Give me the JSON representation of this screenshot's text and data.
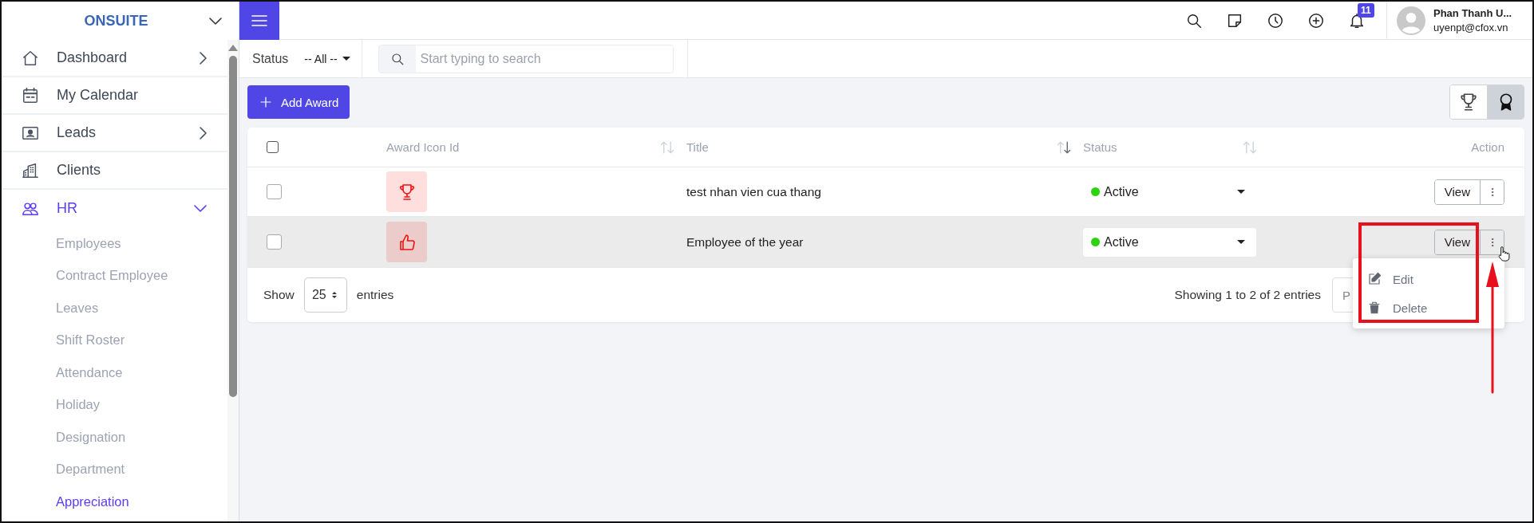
{
  "sidebar": {
    "logo": "ONSUITE",
    "items": [
      {
        "label": "Dashboard",
        "kind": "group",
        "expanded": false,
        "selected": false
      },
      {
        "label": "My Calendar",
        "kind": "link",
        "selected": false
      },
      {
        "label": "Leads",
        "kind": "group",
        "expanded": false,
        "selected": false
      },
      {
        "label": "Clients",
        "kind": "link",
        "selected": false
      },
      {
        "label": "HR",
        "kind": "group",
        "expanded": true,
        "selected": true,
        "children": [
          {
            "label": "Employees",
            "selected": false
          },
          {
            "label": "Contract Employee",
            "selected": false
          },
          {
            "label": "Leaves",
            "selected": false
          },
          {
            "label": "Shift Roster",
            "selected": false
          },
          {
            "label": "Attendance",
            "selected": false
          },
          {
            "label": "Holiday",
            "selected": false
          },
          {
            "label": "Designation",
            "selected": false
          },
          {
            "label": "Department",
            "selected": false
          },
          {
            "label": "Appreciation",
            "selected": true
          }
        ]
      }
    ]
  },
  "header": {
    "notification_count": "11",
    "user_name": "Phan Thanh U...",
    "user_email": "uyenpt@cfox.vn"
  },
  "filters": {
    "status_label": "Status",
    "status_value": "-- All --",
    "search": {
      "placeholder": "Start typing to search"
    }
  },
  "add_button": "Add Award",
  "view_toggle": [
    {
      "selected": false
    },
    {
      "selected": true
    }
  ],
  "table": {
    "columns": [
      {
        "kind": "checkbox",
        "checked": false
      },
      {
        "kind": "text",
        "label": "Award Icon Id",
        "sorted": false
      },
      {
        "kind": "text",
        "label": "Title",
        "sorted": true
      },
      {
        "kind": "text",
        "label": "Status",
        "sorted": false
      },
      {
        "kind": "action",
        "label": "Action"
      }
    ],
    "rows": [
      {
        "checked": false,
        "hovered": false,
        "title": "test nhan vien cua thang",
        "status": "Active",
        "color": "#2bd40f",
        "view": "View"
      },
      {
        "checked": false,
        "hovered": true,
        "title": "Employee of the year",
        "status": "Active",
        "color": "#2bd40f",
        "view": "View",
        "menu": [
          {
            "label": "Edit"
          },
          {
            "label": "Delete"
          }
        ]
      }
    ],
    "footer": {
      "show_label": "Show",
      "page_size": "25",
      "entries_label": "entries",
      "info": "Showing 1 to 2 of 2 entries",
      "prev_button": "P"
    }
  }
}
